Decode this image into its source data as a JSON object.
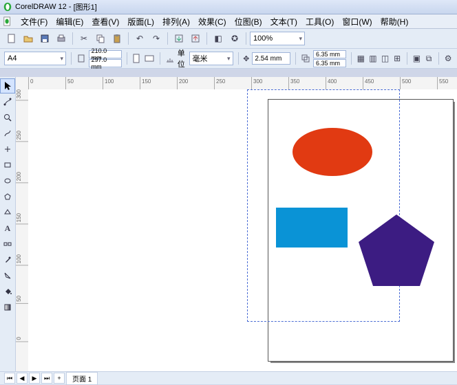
{
  "title_bar": {
    "app_name": "CorelDRAW 12",
    "doc_name": "[图形1]"
  },
  "menu": {
    "file": "文件(F)",
    "edit": "编辑(E)",
    "view": "查看(V)",
    "layout": "版面(L)",
    "arrange": "排列(A)",
    "effects": "效果(C)",
    "bitmap": "位图(B)",
    "text": "文本(T)",
    "tools": "工具(O)",
    "window": "窗口(W)",
    "help": "帮助(H)"
  },
  "toolbar1": {
    "zoom": "100%"
  },
  "propbar": {
    "paper_size": "A4",
    "page_w": "210.0 mm",
    "page_h": "297.0 mm",
    "units_label": "单位",
    "units": "毫米",
    "nudge": "2.54 mm",
    "dup_x": "6.35 mm",
    "dup_y": "6.35 mm"
  },
  "ruler_h": [
    0,
    50,
    100,
    150,
    200,
    250,
    300,
    350,
    400,
    450,
    500,
    550
  ],
  "ruler_v": [
    300,
    250,
    200,
    150,
    100,
    50,
    0
  ],
  "shapes": {
    "ellipse_fill": "#e13a12",
    "rect_fill": "#0a93d6",
    "penta_fill": "#3c1c82"
  },
  "status": {
    "page_label": "页面 1"
  }
}
